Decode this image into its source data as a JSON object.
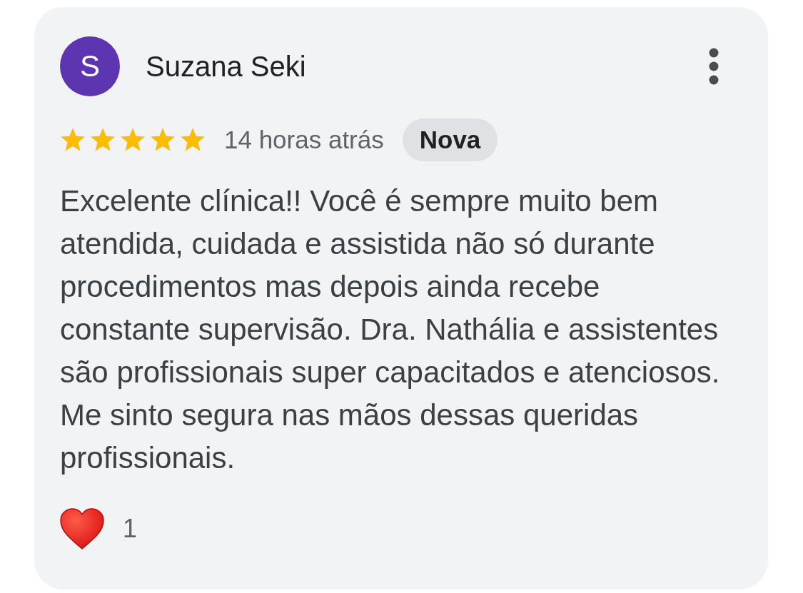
{
  "review": {
    "avatar_letter": "S",
    "author": "Suzana Seki",
    "stars": 5,
    "time": "14 horas atrás",
    "badge": "Nova",
    "text": "Excelente clínica!! Você é sempre muito bem atendida, cuidada e assistida não só durante procedimentos mas depois ainda recebe constante supervisão. Dra. Nathália e assistentes são profissionais super capacitados e atenciosos. Me sinto segura nas mãos dessas queridas profissionais.",
    "reaction_count": "1"
  }
}
